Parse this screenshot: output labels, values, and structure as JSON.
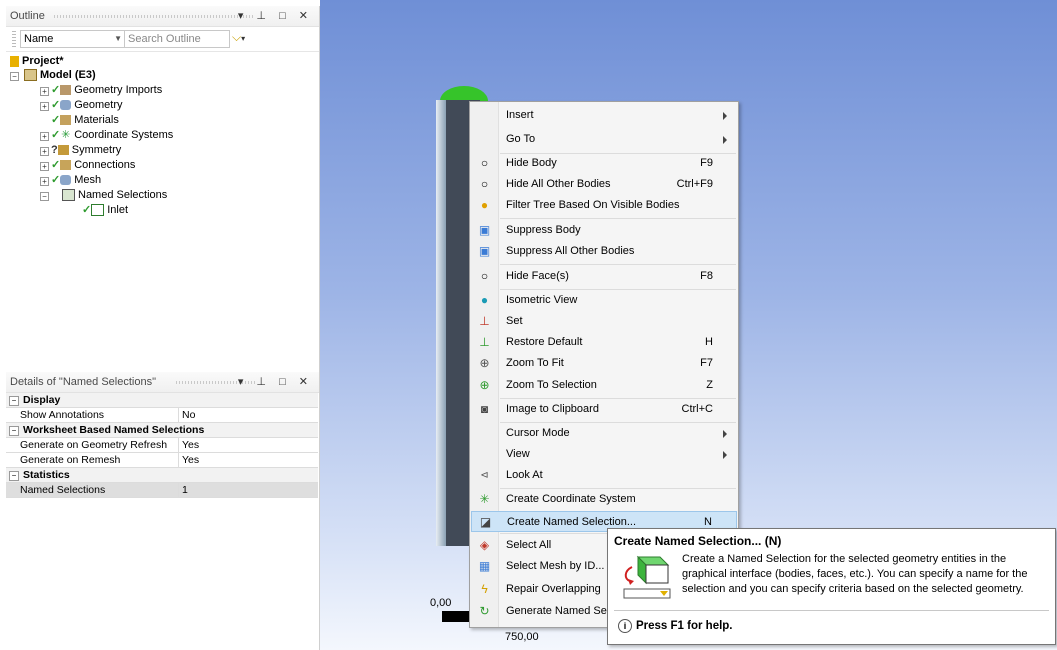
{
  "outline": {
    "title": "Outline",
    "controls": "▾ ❑ □ ✕",
    "name_combo": "Name",
    "search_placeholder": "Search Outline",
    "tree": {
      "project": "Project*",
      "model": "Model (E3)",
      "items": [
        "Geometry Imports",
        "Geometry",
        "Materials",
        "Coordinate Systems",
        "Symmetry",
        "Connections",
        "Mesh",
        "Named Selections"
      ],
      "child": "Inlet"
    }
  },
  "details": {
    "title": "Details of \"Named Selections\"",
    "sections": [
      {
        "label": "Display",
        "rows": [
          {
            "name": "Show Annotations",
            "value": "No"
          }
        ]
      },
      {
        "label": "Worksheet Based Named Selections",
        "rows": [
          {
            "name": "Generate on Geometry Refresh",
            "value": "Yes"
          },
          {
            "name": "Generate on Remesh",
            "value": "Yes"
          }
        ]
      },
      {
        "label": "Statistics",
        "rows": [
          {
            "name": "Named Selections",
            "value": "1"
          }
        ]
      }
    ]
  },
  "viewport": {
    "scale_start": "0,00",
    "scale_end": "750,00"
  },
  "menu": {
    "items": [
      {
        "label": "Insert",
        "shortcut": "",
        "submenu": true,
        "icon": ""
      },
      {
        "label": "Go To",
        "shortcut": "",
        "submenu": true,
        "icon": ""
      },
      {
        "label": "Hide Body",
        "shortcut": "F9",
        "icon": "lightbulb-icon"
      },
      {
        "label": "Hide All Other Bodies",
        "shortcut": "Ctrl+F9",
        "icon": "lightbulb-icon"
      },
      {
        "label": "Filter Tree Based On Visible Bodies",
        "shortcut": "",
        "icon": "lightbulb-on-icon"
      },
      {
        "label": "Suppress Body",
        "shortcut": "",
        "icon": "suppress-icon"
      },
      {
        "label": "Suppress All Other Bodies",
        "shortcut": "",
        "icon": "suppress-icon"
      },
      {
        "label": "Hide Face(s)",
        "shortcut": "F8",
        "icon": "lightbulb-icon"
      },
      {
        "label": "Isometric View",
        "shortcut": "",
        "icon": "sphere-icon"
      },
      {
        "label": "Set",
        "shortcut": "",
        "icon": "axes-icon"
      },
      {
        "label": "Restore Default",
        "shortcut": "H",
        "icon": "axes-icon"
      },
      {
        "label": "Zoom To Fit",
        "shortcut": "F7",
        "icon": "zoom-icon"
      },
      {
        "label": "Zoom To Selection",
        "shortcut": "Z",
        "icon": "zoom-icon"
      },
      {
        "label": "Image to Clipboard",
        "shortcut": "Ctrl+C",
        "icon": "camera-icon"
      },
      {
        "label": "Cursor Mode",
        "shortcut": "",
        "submenu": true,
        "icon": ""
      },
      {
        "label": "View",
        "shortcut": "",
        "submenu": true,
        "icon": ""
      },
      {
        "label": "Look At",
        "shortcut": "",
        "icon": "look-at-icon"
      },
      {
        "label": "Create Coordinate System",
        "shortcut": "",
        "icon": "coord-icon"
      },
      {
        "label": "Create Named Selection...",
        "shortcut": "N",
        "icon": "named-selection-icon"
      },
      {
        "label": "Select All",
        "shortcut": "",
        "icon": "select-all-icon"
      },
      {
        "label": "Select Mesh by ID...",
        "shortcut": "",
        "icon": "mesh-id-icon"
      },
      {
        "label": "Repair Overlapping",
        "shortcut": "",
        "icon": "repair-icon"
      },
      {
        "label": "Generate Named Se",
        "shortcut": "",
        "icon": "generate-icon"
      }
    ]
  },
  "tooltip": {
    "title": "Create Named Selection... (N)",
    "body": "Create a Named Selection for the selected geometry entities in the graphical interface (bodies, faces, etc.). You can specify a name for the selection and you can specify criteria based on the selected geometry.",
    "help": "Press F1 for help."
  },
  "colors": {
    "accent": "#cde4f7",
    "check": "#2e9a2e",
    "viewport_top": "#6f8fd6"
  }
}
